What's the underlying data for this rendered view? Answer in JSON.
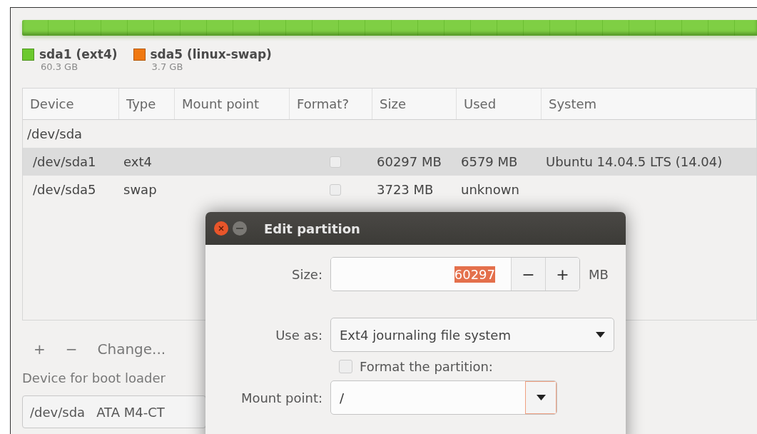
{
  "legend": [
    {
      "name": "sda1 (ext4)",
      "size": "60.3 GB",
      "color": "#6cc92e"
    },
    {
      "name": "sda5 (linux-swap)",
      "size": "3.7 GB",
      "color": "#f0780f"
    }
  ],
  "table": {
    "columns": [
      "Device",
      "Type",
      "Mount point",
      "Format?",
      "Size",
      "Used",
      "System"
    ],
    "rows": [
      {
        "kind": "disk",
        "device": "/dev/sda",
        "selected": false
      },
      {
        "kind": "partition",
        "device": "/dev/sda1",
        "type": "ext4",
        "mount": "",
        "format_checked": false,
        "size": "60297 MB",
        "used": "6579 MB",
        "system": "Ubuntu 14.04.5 LTS (14.04)",
        "selected": true
      },
      {
        "kind": "partition",
        "device": "/dev/sda5",
        "type": "swap",
        "mount": "",
        "format_checked": false,
        "size": "3723 MB",
        "used": "unknown",
        "system": "",
        "selected": false
      }
    ]
  },
  "actions": {
    "add": "+",
    "remove": "−",
    "change": "Change..."
  },
  "boot_loader": {
    "label": "Device for boot loader",
    "device": "/dev/sda",
    "model": "ATA M4-CT"
  },
  "dialog": {
    "title": "Edit partition",
    "size": {
      "label": "Size:",
      "value": "60297",
      "decrement": "−",
      "increment": "+",
      "unit": "MB"
    },
    "use_as": {
      "label": "Use as:",
      "value": "Ext4 journaling file system"
    },
    "format": {
      "label": "Format the partition:",
      "checked": false
    },
    "mount_point": {
      "label": "Mount point:",
      "value": "/"
    }
  }
}
